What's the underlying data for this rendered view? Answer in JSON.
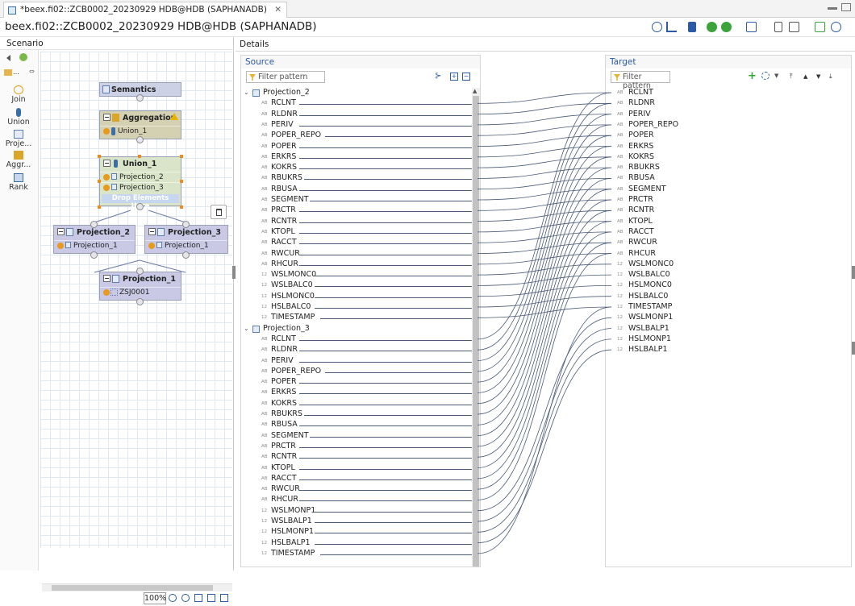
{
  "tab": {
    "label": "*beex.fi02::ZCB0002_20230929 HDB@HDB (SAPHANADB)",
    "close": "✕"
  },
  "window": {
    "title": "beex.fi02::ZCB0002_20230929 HDB@HDB (SAPHANADB)"
  },
  "scenario": {
    "header": "Scenario",
    "palette": [
      {
        "label": "Join",
        "icon": "join-icon"
      },
      {
        "label": "Union",
        "icon": "union-icon"
      },
      {
        "label": "Proje...",
        "icon": "projection-icon"
      },
      {
        "label": "Aggr...",
        "icon": "aggregation-icon"
      },
      {
        "label": "Rank",
        "icon": "rank-icon"
      }
    ],
    "nodes": {
      "semantics": {
        "title": "Semantics"
      },
      "aggregation": {
        "title": "Aggregation",
        "rows": [
          "Union_1"
        ]
      },
      "union": {
        "title": "Union_1",
        "rows": [
          "Projection_2",
          "Projection_3"
        ],
        "drop": "Drop Elements Here"
      },
      "proj2": {
        "title": "Projection_2",
        "rows": [
          "Projection_1"
        ]
      },
      "proj3": {
        "title": "Projection_3",
        "rows": [
          "Projection_1"
        ]
      },
      "proj1": {
        "title": "Projection_1",
        "rows": [
          "ZSJ0001"
        ]
      }
    },
    "zoom": "100%"
  },
  "details": {
    "header": "Details",
    "source": {
      "title": "Source",
      "filter_placeholder": "Filter pattern",
      "groups": [
        {
          "name": "Projection_2",
          "fields": [
            {
              "name": "RCLNT",
              "type": "AB"
            },
            {
              "name": "RLDNR",
              "type": "AB"
            },
            {
              "name": "PERIV",
              "type": "AB"
            },
            {
              "name": "POPER_REPO",
              "type": "AB"
            },
            {
              "name": "POPER",
              "type": "AB"
            },
            {
              "name": "ERKRS",
              "type": "AB"
            },
            {
              "name": "KOKRS",
              "type": "AB"
            },
            {
              "name": "RBUKRS",
              "type": "AB"
            },
            {
              "name": "RBUSA",
              "type": "AB"
            },
            {
              "name": "SEGMENT",
              "type": "AB"
            },
            {
              "name": "PRCTR",
              "type": "AB"
            },
            {
              "name": "RCNTR",
              "type": "AB"
            },
            {
              "name": "KTOPL",
              "type": "AB"
            },
            {
              "name": "RACCT",
              "type": "AB"
            },
            {
              "name": "RWCUR",
              "type": "AB"
            },
            {
              "name": "RHCUR",
              "type": "AB"
            },
            {
              "name": "WSLMONC0",
              "type": "12"
            },
            {
              "name": "WSLBALC0",
              "type": "12"
            },
            {
              "name": "HSLMONC0",
              "type": "12"
            },
            {
              "name": "HSLBALC0",
              "type": "12"
            },
            {
              "name": "TIMESTAMP",
              "type": "12"
            }
          ]
        },
        {
          "name": "Projection_3",
          "fields": [
            {
              "name": "RCLNT",
              "type": "AB"
            },
            {
              "name": "RLDNR",
              "type": "AB"
            },
            {
              "name": "PERIV",
              "type": "AB"
            },
            {
              "name": "POPER_REPO",
              "type": "AB"
            },
            {
              "name": "POPER",
              "type": "AB"
            },
            {
              "name": "ERKRS",
              "type": "AB"
            },
            {
              "name": "KOKRS",
              "type": "AB"
            },
            {
              "name": "RBUKRS",
              "type": "AB"
            },
            {
              "name": "RBUSA",
              "type": "AB"
            },
            {
              "name": "SEGMENT",
              "type": "AB"
            },
            {
              "name": "PRCTR",
              "type": "AB"
            },
            {
              "name": "RCNTR",
              "type": "AB"
            },
            {
              "name": "KTOPL",
              "type": "AB"
            },
            {
              "name": "RACCT",
              "type": "AB"
            },
            {
              "name": "RWCUR",
              "type": "AB"
            },
            {
              "name": "RHCUR",
              "type": "AB"
            },
            {
              "name": "WSLMONP1",
              "type": "12"
            },
            {
              "name": "WSLBALP1",
              "type": "12"
            },
            {
              "name": "HSLMONP1",
              "type": "12"
            },
            {
              "name": "HSLBALP1",
              "type": "12"
            },
            {
              "name": "TIMESTAMP",
              "type": "12"
            }
          ]
        }
      ]
    },
    "target": {
      "title": "Target",
      "filter_placeholder": "Filter pattern",
      "fields": [
        {
          "name": "RCLNT",
          "type": "AB"
        },
        {
          "name": "RLDNR",
          "type": "AB"
        },
        {
          "name": "PERIV",
          "type": "AB"
        },
        {
          "name": "POPER_REPO",
          "type": "AB"
        },
        {
          "name": "POPER",
          "type": "AB"
        },
        {
          "name": "ERKRS",
          "type": "AB"
        },
        {
          "name": "KOKRS",
          "type": "AB"
        },
        {
          "name": "RBUKRS",
          "type": "AB"
        },
        {
          "name": "RBUSA",
          "type": "AB"
        },
        {
          "name": "SEGMENT",
          "type": "AB"
        },
        {
          "name": "PRCTR",
          "type": "AB"
        },
        {
          "name": "RCNTR",
          "type": "AB"
        },
        {
          "name": "KTOPL",
          "type": "AB"
        },
        {
          "name": "RACCT",
          "type": "AB"
        },
        {
          "name": "RWCUR",
          "type": "AB"
        },
        {
          "name": "RHCUR",
          "type": "AB"
        },
        {
          "name": "WSLMONC0",
          "type": "12"
        },
        {
          "name": "WSLBALC0",
          "type": "12"
        },
        {
          "name": "HSLMONC0",
          "type": "12"
        },
        {
          "name": "HSLBALC0",
          "type": "12"
        },
        {
          "name": "TIMESTAMP",
          "type": "12"
        },
        {
          "name": "WSLMONP1",
          "type": "12"
        },
        {
          "name": "WSLBALP1",
          "type": "12"
        },
        {
          "name": "HSLMONP1",
          "type": "12"
        },
        {
          "name": "HSLBALP1",
          "type": "12"
        }
      ]
    },
    "mappings": {
      "group1": [
        0,
        1,
        2,
        3,
        4,
        5,
        6,
        7,
        8,
        9,
        10,
        11,
        12,
        13,
        14,
        15,
        16,
        17,
        18,
        19,
        20
      ],
      "group2": [
        0,
        1,
        2,
        3,
        4,
        5,
        6,
        7,
        8,
        9,
        10,
        11,
        12,
        13,
        14,
        15,
        21,
        22,
        23,
        24,
        20
      ]
    }
  },
  "colors": {
    "accent": "#2a5aa8",
    "line": "#4a5a78",
    "node_semantics": "#cdd1e6",
    "node_aggregation": "#d4d0b2",
    "node_union": "#d9e4c9",
    "node_projection": "#c9c9e6",
    "selection": "#f28a16"
  }
}
